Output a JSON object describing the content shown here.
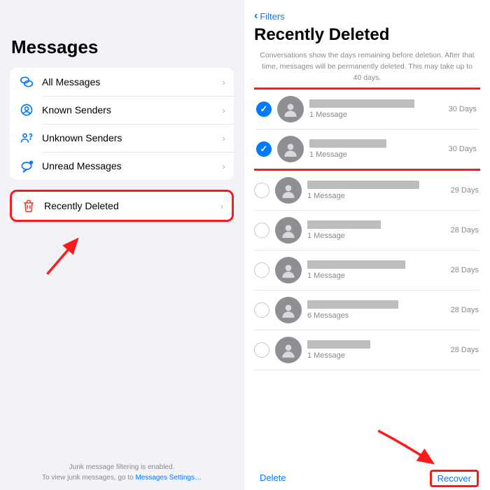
{
  "left": {
    "title": "Messages",
    "filters": [
      {
        "icon": "bubbles",
        "label": "All Messages"
      },
      {
        "icon": "person-circle",
        "label": "Known Senders"
      },
      {
        "icon": "person-question",
        "label": "Unknown Senders"
      },
      {
        "icon": "bubble-dot",
        "label": "Unread Messages"
      }
    ],
    "recently_deleted_label": "Recently Deleted",
    "footer1": "Junk message filtering is enabled.",
    "footer2_a": "To view junk messages, go to ",
    "footer2_link": "Messages Settings…"
  },
  "right": {
    "back_label": "Filters",
    "title": "Recently Deleted",
    "subtitle": "Conversations show the days remaining before deletion. After that time, messages will be permanently deleted. This may take up to 40 days.",
    "conversations": [
      {
        "selected": true,
        "name_w": 150,
        "count": "1 Message",
        "days": "30 Days"
      },
      {
        "selected": true,
        "name_w": 110,
        "count": "1 Message",
        "days": "30 Days"
      },
      {
        "selected": false,
        "name_w": 160,
        "count": "1 Message",
        "days": "29 Days"
      },
      {
        "selected": false,
        "name_w": 105,
        "count": "1 Message",
        "days": "28 Days"
      },
      {
        "selected": false,
        "name_w": 140,
        "count": "1 Message",
        "days": "28 Days"
      },
      {
        "selected": false,
        "name_w": 130,
        "count": "6 Messages",
        "days": "28 Days"
      },
      {
        "selected": false,
        "name_w": 90,
        "count": "1 Message",
        "days": "28 Days"
      }
    ],
    "delete_label": "Delete",
    "recover_label": "Recover"
  }
}
